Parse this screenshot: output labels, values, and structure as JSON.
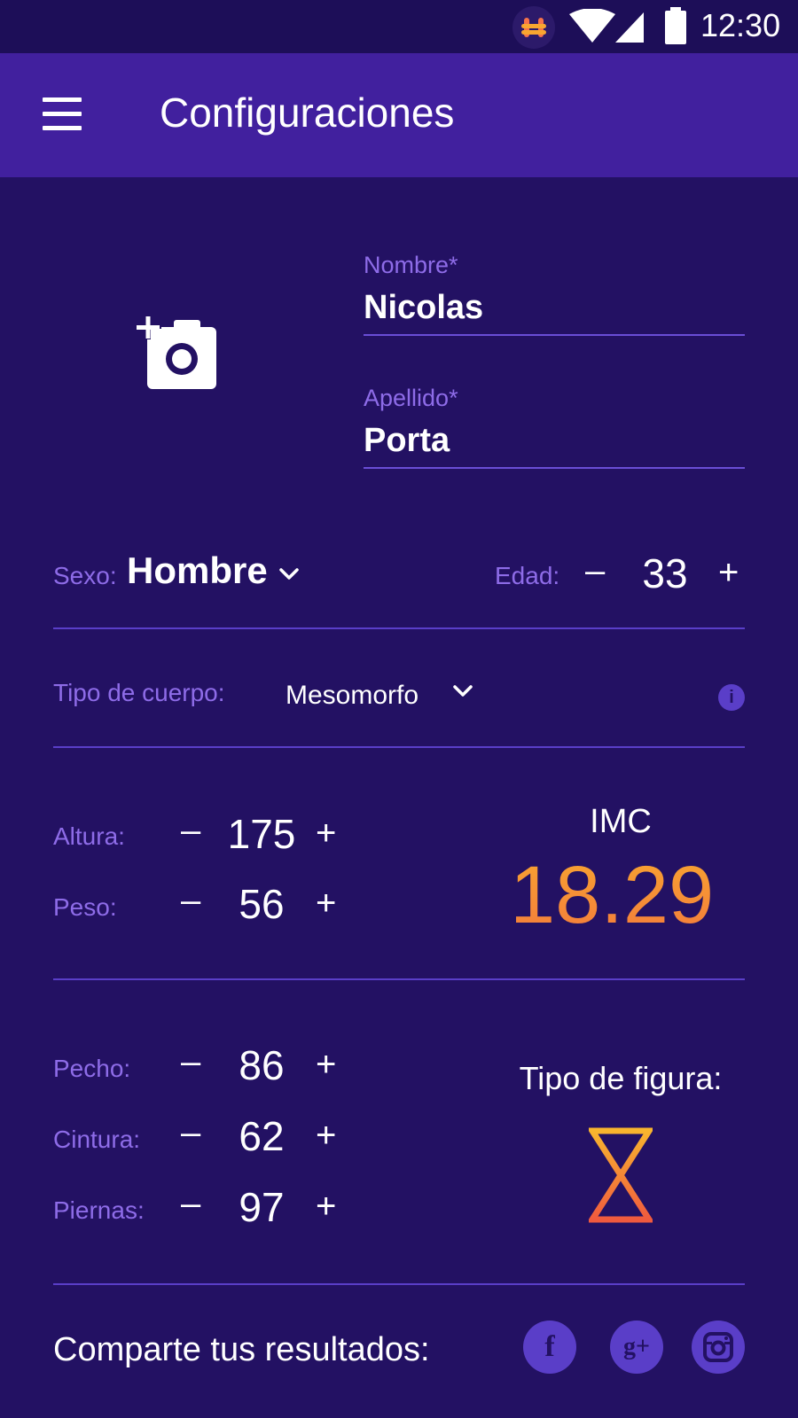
{
  "status_bar": {
    "time": "12:30",
    "app_icon": "hive-icon",
    "wifi_icon": "wifi-icon",
    "signal_icon": "signal-icon",
    "battery_icon": "battery-icon"
  },
  "app_bar": {
    "title": "Configuraciones",
    "menu_icon": "hamburger-menu-icon"
  },
  "profile": {
    "photo_icon": "add-photo-camera-icon",
    "first_name_label": "Nombre*",
    "first_name_value": "Nicolas",
    "last_name_label": "Apellido*",
    "last_name_value": "Porta"
  },
  "sex": {
    "label": "Sexo:",
    "value": "Hombre"
  },
  "age": {
    "label": "Edad:",
    "minus": "–",
    "value": "33",
    "plus": "+"
  },
  "body_type": {
    "label": "Tipo de cuerpo:",
    "value": "Mesomorfo",
    "info_icon": "info-icon",
    "info_glyph": "i"
  },
  "measurements_a": {
    "height": {
      "label": "Altura:",
      "minus": "–",
      "value": "175",
      "plus": "+"
    },
    "weight": {
      "label": "Peso:",
      "minus": "–",
      "value": "56",
      "plus": "+"
    }
  },
  "imc": {
    "label": "IMC",
    "value": "18.29"
  },
  "measurements_b": {
    "chest": {
      "label": "Pecho:",
      "minus": "–",
      "value": "86",
      "plus": "+"
    },
    "waist": {
      "label": "Cintura:",
      "minus": "–",
      "value": "62",
      "plus": "+"
    },
    "legs": {
      "label": "Piernas:",
      "minus": "–",
      "value": "97",
      "plus": "+"
    }
  },
  "figure": {
    "label": "Tipo de figura:",
    "icon": "hourglass-figure-icon"
  },
  "share": {
    "label": "Comparte tus resultados:",
    "facebook_glyph": "f",
    "googleplus_glyph": "g+",
    "networks": [
      "facebook-icon",
      "google-plus-icon",
      "instagram-icon"
    ]
  },
  "colors": {
    "background": "#231163",
    "app_bar": "#41209e",
    "label": "#8e6ce8",
    "divider": "#5a3ec8",
    "accent_gradient_top": "#f8a630",
    "accent_gradient_bottom": "#f37a3c"
  }
}
